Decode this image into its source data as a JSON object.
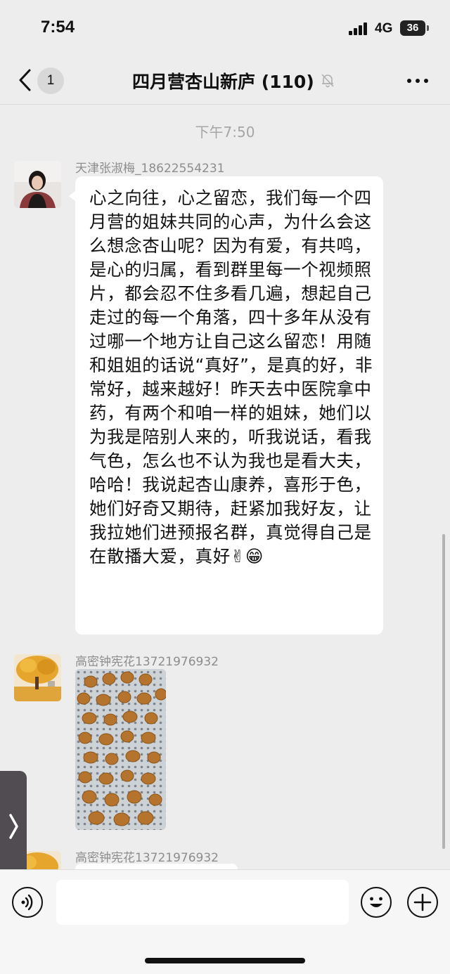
{
  "status_bar": {
    "time": "7:54",
    "network": "4G",
    "battery": "36"
  },
  "nav": {
    "unread_count": "1",
    "title": "四月营杏山新庐 (110)"
  },
  "chat": {
    "timestamp": "下午7:50",
    "messages": [
      {
        "sender": "天津张淑梅_18622554231",
        "text": "心之向往，心之留恋，我们每一个四月营的姐妹共同的心声，为什么会这么想念杏山呢？因为有爱，有共鸣，是心的归属，看到群里每一个视频照片，都会忍不住多看几遍，想起自己走过的每一个角落，四十多年从没有过哪一个地方让自己这么留恋！用随和姐姐的话说“真好”，是真的好，非常好，越来越好！昨天去中医院拿中药，有两个和咱一样的姐妹，她们以为我是陪别人来的，听我说话，看我气色，怎么也不认为我也是看大夫，哈哈！我说起杏山康养，喜形于色，她们好奇又期待，赶紧加我好友，让我拉她们进预报名群，真觉得自己是在散播大爱，真好✌😁"
      },
      {
        "sender": "高密钟宪花13721976932",
        "content": "photo"
      },
      {
        "sender": "高密钟宪花13721976932",
        "content": "partial"
      }
    ]
  },
  "icons": {
    "back": "chevron-left-icon",
    "mute": "bell-slash-icon",
    "more": "more-dots-icon",
    "side_tab": "chevron-right-icon",
    "voice": "voice-icon",
    "emoji": "emoji-icon",
    "plus": "plus-icon"
  }
}
